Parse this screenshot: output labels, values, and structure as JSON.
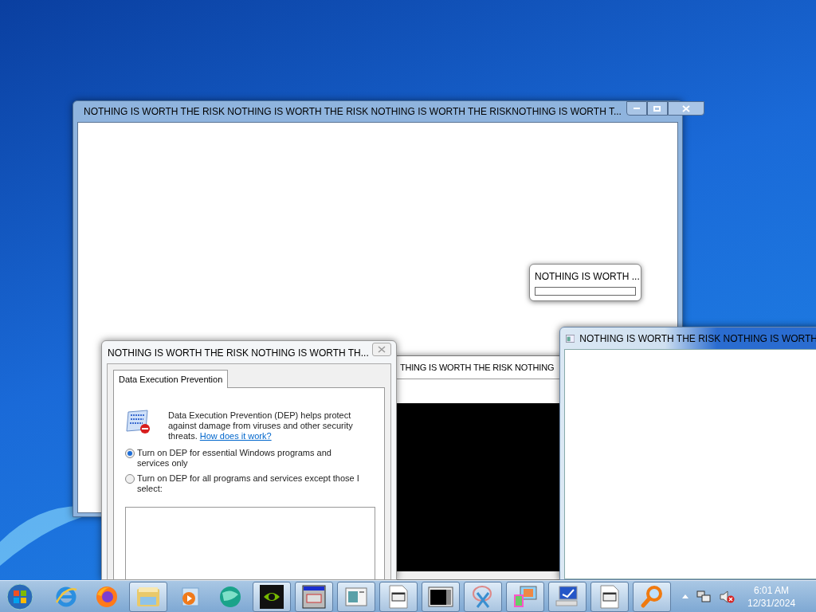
{
  "main_window": {
    "title": "NOTHING IS WORTH THE RISK NOTHING IS WORTH THE RISK NOTHING IS WORTH THE RISKNOTHING IS WORTH T..."
  },
  "progress_popup": {
    "text": "NOTHING IS WORTH ...",
    "level": 0
  },
  "background_window": {
    "title": "THING IS WORTH THE RISK NOTHING"
  },
  "right_window": {
    "title": "NOTHING IS WORTH THE RISK NOTHING IS WORTH"
  },
  "dep_dialog": {
    "title": "NOTHING IS WORTH THE RISK NOTHING IS WORTH TH...",
    "tabs": [
      {
        "label": "Data Execution Prevention",
        "selected": true
      }
    ],
    "description": "Data Execution Prevention (DEP) helps protect against damage from viruses and other security threats.",
    "link": "How does it work?",
    "options": [
      {
        "label": "Turn on DEP for essential Windows programs and services only",
        "selected": true
      },
      {
        "label": "Turn on DEP for all programs and services except those I select:",
        "selected": false
      }
    ]
  },
  "taskbar": {
    "items": [
      {
        "kind": "browser-e",
        "open": false
      },
      {
        "kind": "fox",
        "open": false
      },
      {
        "kind": "folder",
        "open": true
      },
      {
        "kind": "play",
        "open": false
      },
      {
        "kind": "sphere",
        "open": false
      },
      {
        "kind": "eye",
        "open": true
      },
      {
        "kind": "mci",
        "open": true
      },
      {
        "kind": "window",
        "open": true
      },
      {
        "kind": "exe",
        "open": true
      },
      {
        "kind": "black",
        "open": true
      },
      {
        "kind": "scissors",
        "open": true
      },
      {
        "kind": "colors",
        "open": true
      },
      {
        "kind": "monitor",
        "open": true
      },
      {
        "kind": "exe",
        "open": true
      },
      {
        "kind": "magnifier",
        "open": true
      }
    ],
    "clock": {
      "time": "6:01 AM",
      "date": "12/31/2024"
    }
  }
}
